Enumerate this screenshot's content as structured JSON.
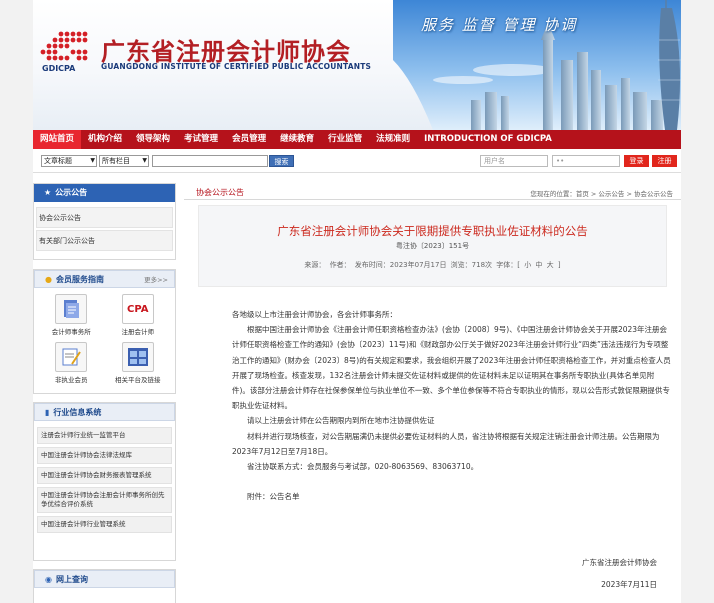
{
  "header": {
    "org_name_cn": "广东省注册会计师协会",
    "org_name_en": "GUANGDONG INSTITUTE OF CERTIFIED PUBLIC ACCOUNTANTS",
    "logo_text": "GDICPA",
    "slogan": "服务 监督 管理 协调"
  },
  "nav": {
    "items": [
      "网站首页",
      "机构介绍",
      "领导架构",
      "考试管理",
      "会员管理",
      "继续教育",
      "行业监管",
      "法规准则",
      "INTRODUCTION OF GDICPA"
    ],
    "active": 0
  },
  "search": {
    "field_select": "文章标题",
    "column_select": "所有栏目",
    "keyword_value": "",
    "search_button": "搜索",
    "username_placeholder": "用户名",
    "password_mask": "••",
    "login_button": "登录",
    "register_button": "注册"
  },
  "sidebar": {
    "announce_title": "公示公告",
    "announce_links": [
      "协会公示公告",
      "有关部门公示公告"
    ],
    "service_title": "会员服务指南",
    "service_more": "更多>>",
    "services": [
      {
        "label": "会计师事务所",
        "icon": "document-stack-icon"
      },
      {
        "label": "注册会计师",
        "icon": "cpa-badge-icon"
      },
      {
        "label": "非执业会员",
        "icon": "certificate-pen-icon"
      },
      {
        "label": "相关平台及链接",
        "icon": "grid-window-icon"
      }
    ],
    "industry_title": "行业信息系统",
    "industry_links": [
      "注册会计师行业统一监管平台",
      "中国注册会计师协会法律法规库",
      "中国注册会计师协会财务报表管理系统",
      "中国注册会计师协会注册会计师事务所创先争优综合评价系统",
      "中国注册会计师行业管理系统"
    ],
    "query_title": "网上查询"
  },
  "main": {
    "section_title": "协会公示公告",
    "breadcrumb": "您现在的位置：首页 > 公示公告 > 协会公示公告",
    "article": {
      "title": "广东省注册会计师协会关于限期提供专职执业佐证材料的公告",
      "doc_no": "粤注协〔2023〕151号",
      "meta": "来源：  作者：  发布时间：2023年07月17日  浏览：718次  字体：[ 小 中 大 ]",
      "salutation": "各地级以上市注册会计师协会，各会计师事务所：",
      "para1": "根据中国注册会计师协会《注册会计师任职资格检查办法》(会协〔2008〕9号)、《中国注册会计师协会关于开展2023年注册会计师任职资格检查工作的通知》(会协〔2023〕11号)和《财政部办公厅关于做好2023年注册会计师行业“四类”违法违规行为专项整治工作的通知》(财办会〔2023〕8号)的有关规定和要求，我会组织开展了2023年注册会计师任职资格检查工作，并对重点检查人员开展了现场检查。核查发现，132名注册会计师未提交佐证材料或提供的佐证材料未足以证明其在事务所专职执业(具体名单见附件)。该部分注册会计师存在社保参保单位与执业单位不一致、多个单位参保等不符合专职执业的情形，现以公告形式敦促限期提供专职执业佐证材料。",
      "para2": "请以上注册会计师在公告期限内到所在地市注协提供佐证",
      "para3": "材料并进行现场核查，对公告期届满仍未提供必要佐证材料的人员，省注协将根据有关规定注销注册会计师注册。公告期限为2023年7月12日至7月18日。",
      "contact": "省注协联系方式：会员服务与考试部，020-8063569、83063710。",
      "attachment": "附件：公告名单",
      "sign_org": "广东省注册会计师协会",
      "sign_date": "2023年7月11日"
    }
  },
  "colors": {
    "brand_red": "#b5121b",
    "nav_active": "#e8262f",
    "title_red": "#cc2a1f",
    "side_blue": "#2d63b4"
  }
}
